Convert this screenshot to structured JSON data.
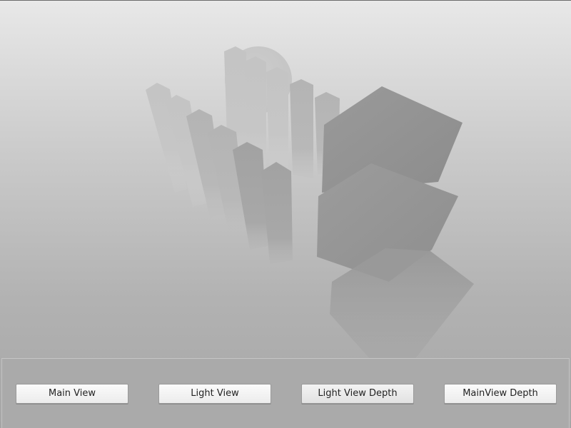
{
  "scene": {
    "description_icon": "3d-depth-scene"
  },
  "buttons": {
    "main_view": "Main View",
    "light_view": "Light View",
    "light_view_depth": "Light View Depth",
    "mainview_depth": "MainView Depth"
  },
  "colors": {
    "panel": "#aaaaaa",
    "button": "#f2f2f2"
  }
}
